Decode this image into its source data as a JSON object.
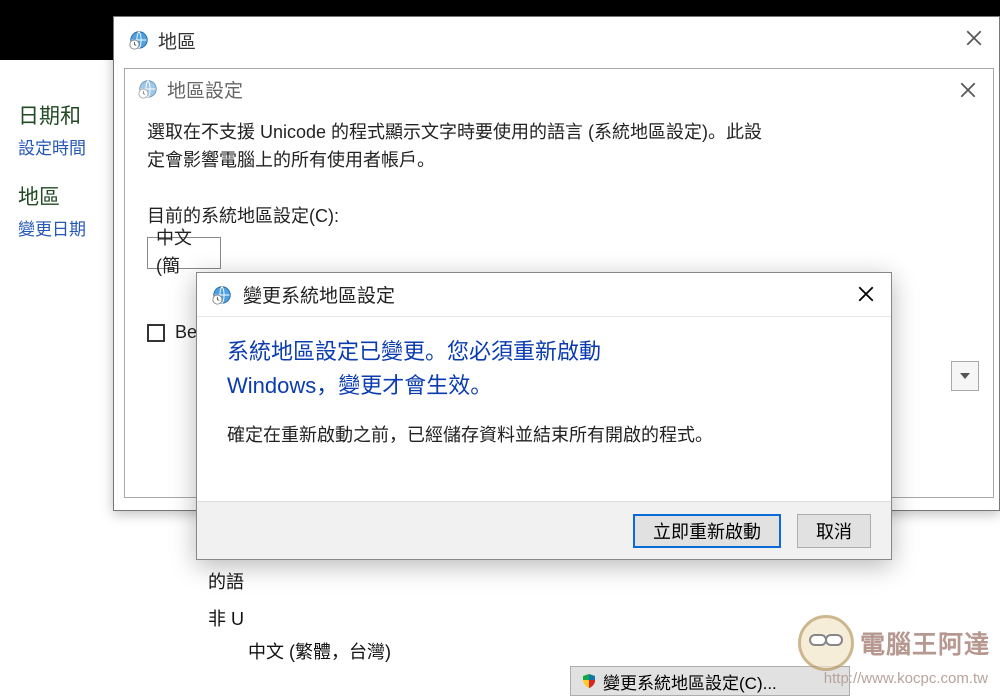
{
  "sidebar": {
    "group1_head": "日期和",
    "group1_link": "設定時間",
    "group2_head": "地區",
    "group2_link": "變更日期"
  },
  "window_region": {
    "title": "地區"
  },
  "window_region_settings": {
    "title": "地區設定",
    "description_line1": "選取在不支援 Unicode 的程式顯示文字時要使用的語言 (系統地區設定)。此設",
    "description_line2": "定會影響電腦上的所有使用者帳戶。",
    "current_locale_label": "目前的系統地區設定(C):",
    "current_locale_value_visible": "中文 (簡",
    "beta_label_visible": "Beta:"
  },
  "dialog": {
    "title": "變更系統地區設定",
    "main_line1": "系統地區設定已變更。您必須重新啟動",
    "main_line2": "Windows，變更才會生效。",
    "sub_text": "確定在重新啟動之前，已經儲存資料並結束所有開啟的程式。",
    "btn_restart": "立即重新啟動",
    "btn_cancel": "取消"
  },
  "below_dialog": {
    "lang_truncated": "的語",
    "non_u_truncated": "非 U",
    "value": "中文 (繁體，台灣)"
  },
  "change_locale_button": "變更系統地區設定(C)...",
  "watermark": {
    "text": "電腦王阿達",
    "url": "http://www.kocpc.com.tw"
  }
}
